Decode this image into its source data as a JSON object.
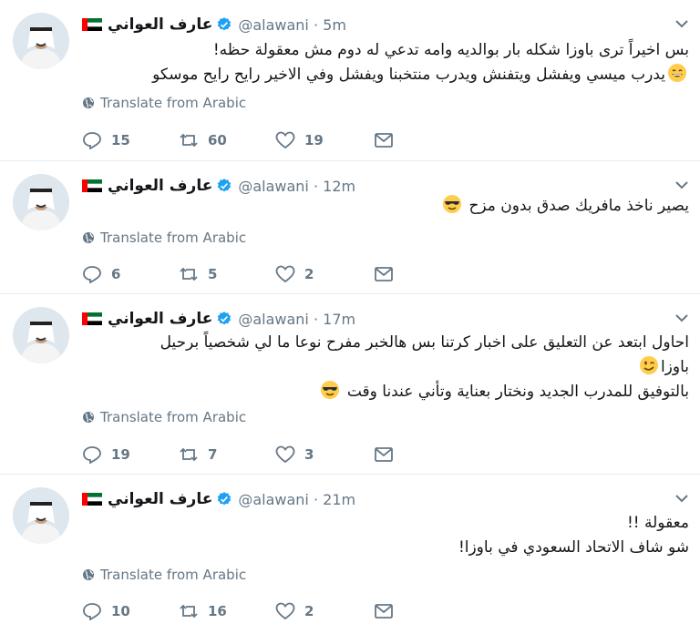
{
  "colors": {
    "text": "#14171a",
    "muted": "#657786",
    "verified": "#1da1f2",
    "divider": "#e6ecf0"
  },
  "tweets": [
    {
      "name": "عارف العواني",
      "handle": "@alawani",
      "sep": "·",
      "time": "5m",
      "lines": [
        "بس اخيراً ترى باوزا شكله بار بوالديه وامه تدعي له دوم مش معقولة حظه!",
        "يدرب ميسي ويفشل ويتفنش ويدرب منتخبنا ويفشل وفي الاخير رايح رايح موسكو"
      ],
      "emoji_after_line": 2,
      "emoji": "grinning-face",
      "translate": "Translate from Arabic",
      "replies": "15",
      "retweets": "60",
      "likes": "19"
    },
    {
      "name": "عارف العواني",
      "handle": "@alawani",
      "sep": "·",
      "time": "12m",
      "lines": [
        "يصير ناخذ مافريك صدق بدون مزح"
      ],
      "emoji": "sunglasses-face",
      "translate": "Translate from Arabic",
      "replies": "6",
      "retweets": "5",
      "likes": "2"
    },
    {
      "name": "عارف العواني",
      "handle": "@alawani",
      "sep": "·",
      "time": "17m",
      "lines": [
        "احاول ابتعد عن التعليق على اخبار كرتنا بس هالخبر مفرح نوعا ما لي شخصياً برحيل",
        "باوزا",
        "بالتوفيق للمدرب الجديد ونختار بعناية وتأني عندنا وقت"
      ],
      "emoji": "winking-face",
      "emoji2": "sunglasses-face",
      "translate": "Translate from Arabic",
      "replies": "19",
      "retweets": "7",
      "likes": "3"
    },
    {
      "name": "عارف العواني",
      "handle": "@alawani",
      "sep": "·",
      "time": "21m",
      "lines": [
        "معقولة !!",
        "شو شاف الاتحاد السعودي في باوزا!"
      ],
      "translate": "Translate from Arabic",
      "replies": "10",
      "retweets": "16",
      "likes": "2"
    }
  ]
}
